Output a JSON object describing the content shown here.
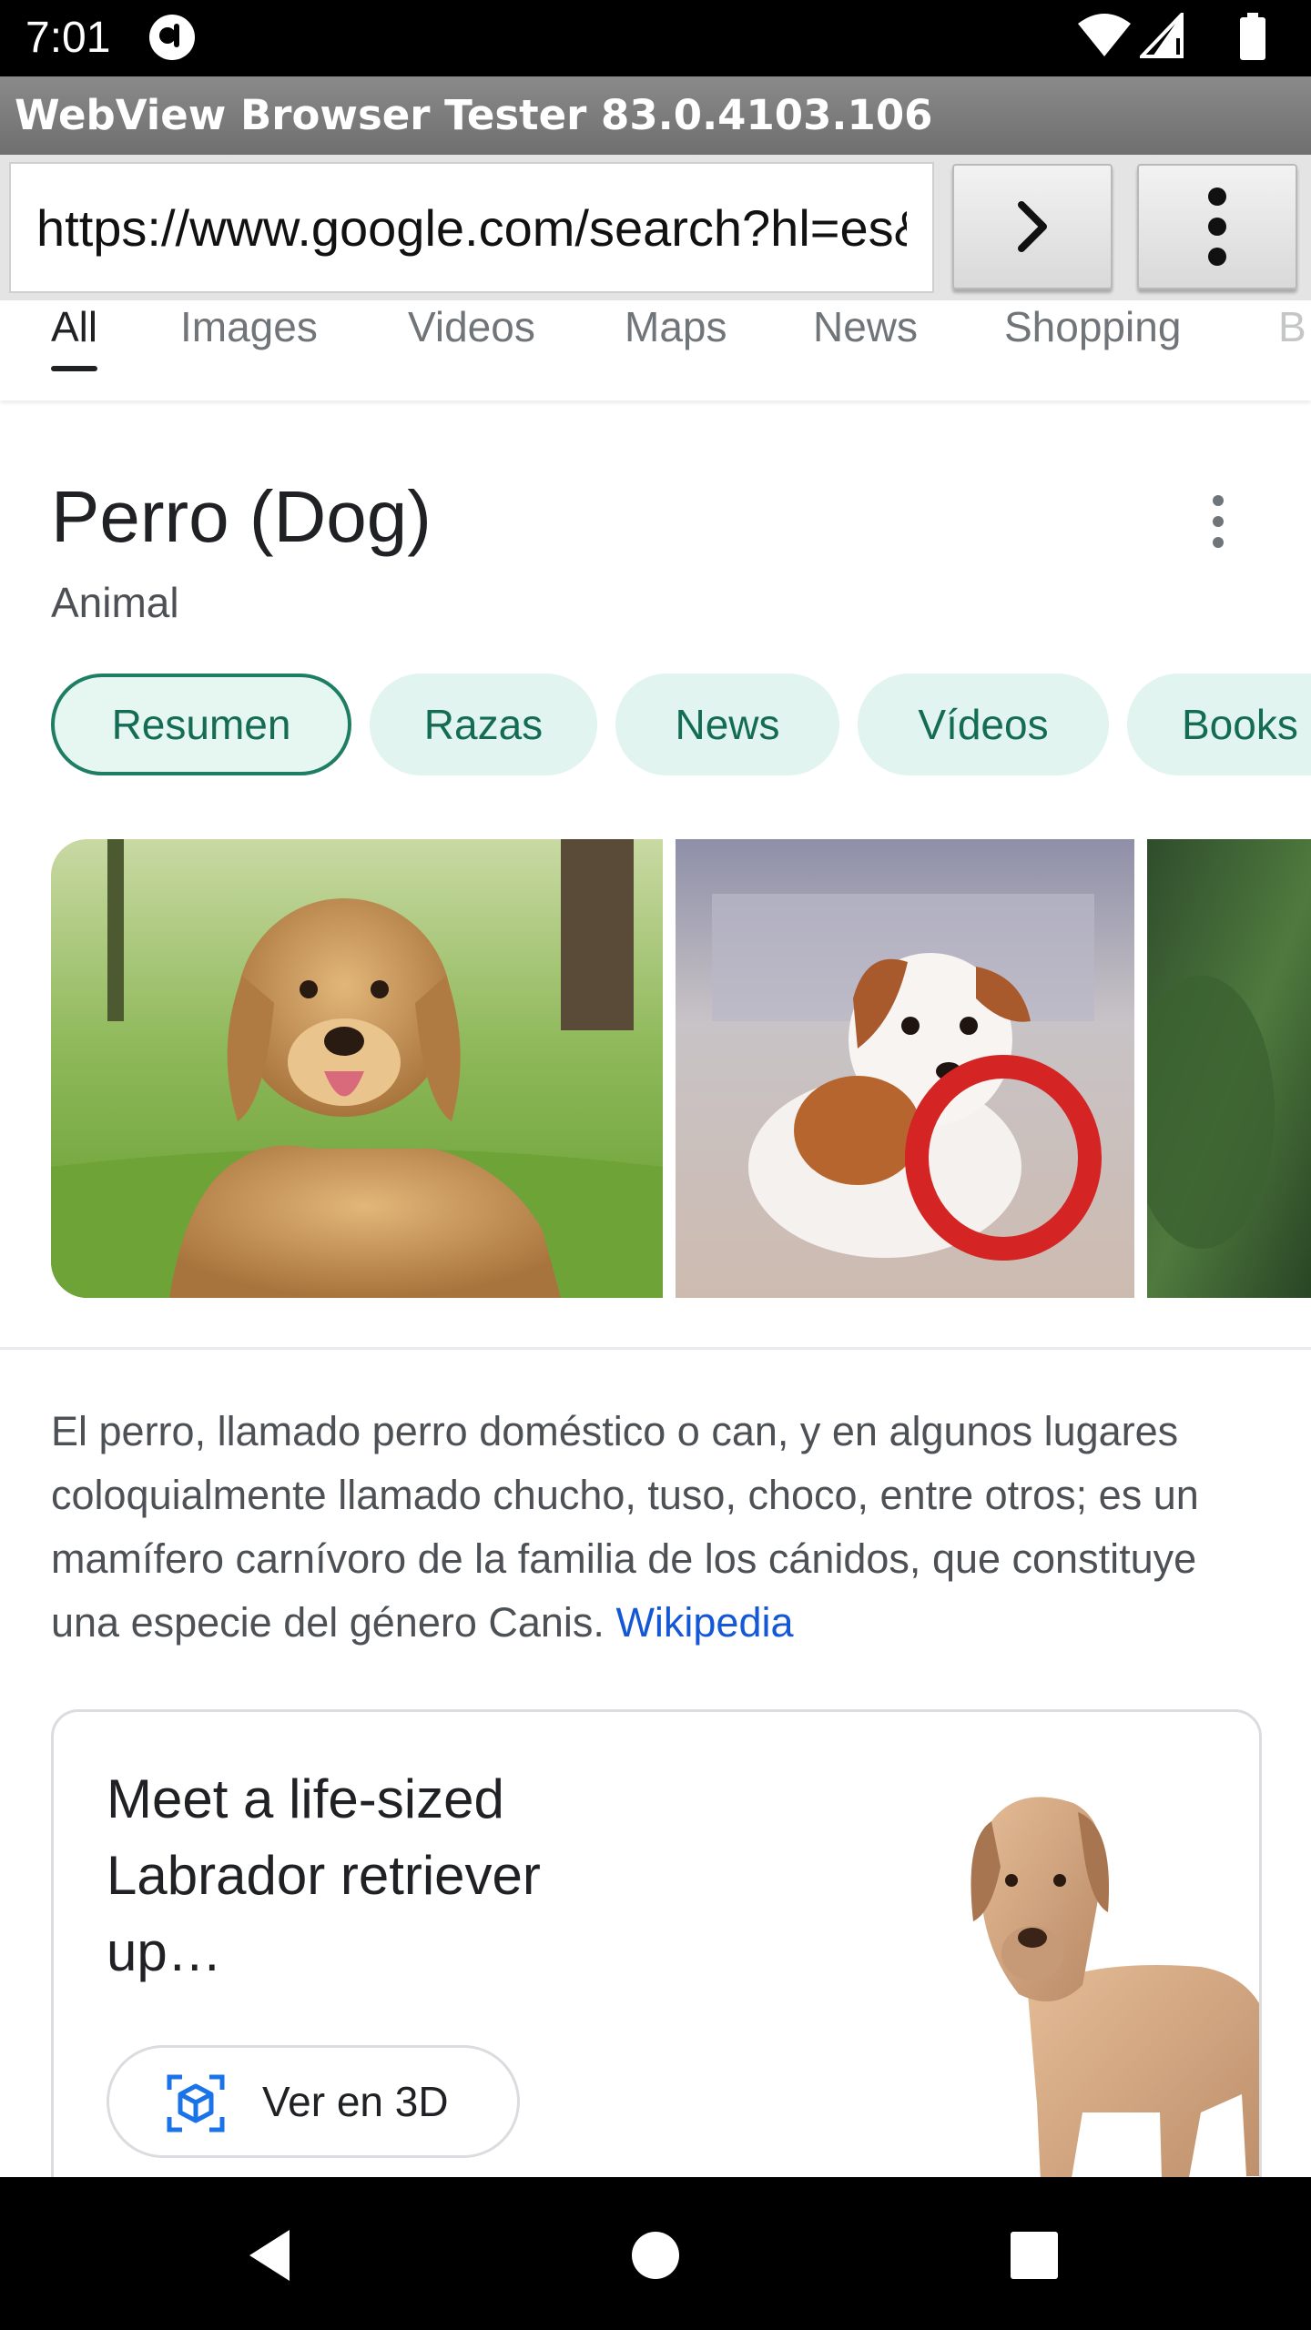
{
  "status_bar": {
    "time": "7:01"
  },
  "app": {
    "title": "WebView Browser Tester 83.0.4103.106"
  },
  "toolbar": {
    "url": "https://www.google.com/search?hl=es&q=perro",
    "go_icon": "chevron-right-icon",
    "menu_icon": "more-vertical-icon"
  },
  "search_tabs": [
    {
      "label": "All",
      "active": true
    },
    {
      "label": "Images",
      "active": false
    },
    {
      "label": "Videos",
      "active": false
    },
    {
      "label": "Maps",
      "active": false
    },
    {
      "label": "News",
      "active": false
    },
    {
      "label": "Shopping",
      "active": false
    },
    {
      "label": "B",
      "active": false
    }
  ],
  "knowledge_panel": {
    "title": "Perro (Dog)",
    "subtitle": "Animal",
    "chips": [
      {
        "label": "Resumen",
        "active": true
      },
      {
        "label": "Razas",
        "active": false
      },
      {
        "label": "News",
        "active": false
      },
      {
        "label": "Vídeos",
        "active": false
      },
      {
        "label": "Books",
        "active": false
      }
    ],
    "description": "El perro,  llamado perro doméstico o can,  y en algunos lugares coloquialmente llamado chucho,  tuso,  choco,  entre otros; es un mamífero carnívoro de la familia de los cánidos, que constituye una especie del género Canis.",
    "source_link": "Wikipedia"
  },
  "card_3d": {
    "title": "Meet a life-sized Labrador retriever up…",
    "button_label": "Ver en 3D"
  },
  "colors": {
    "chip_bg": "#e1f4ef",
    "chip_text": "#146c55",
    "link": "#1558d6"
  }
}
